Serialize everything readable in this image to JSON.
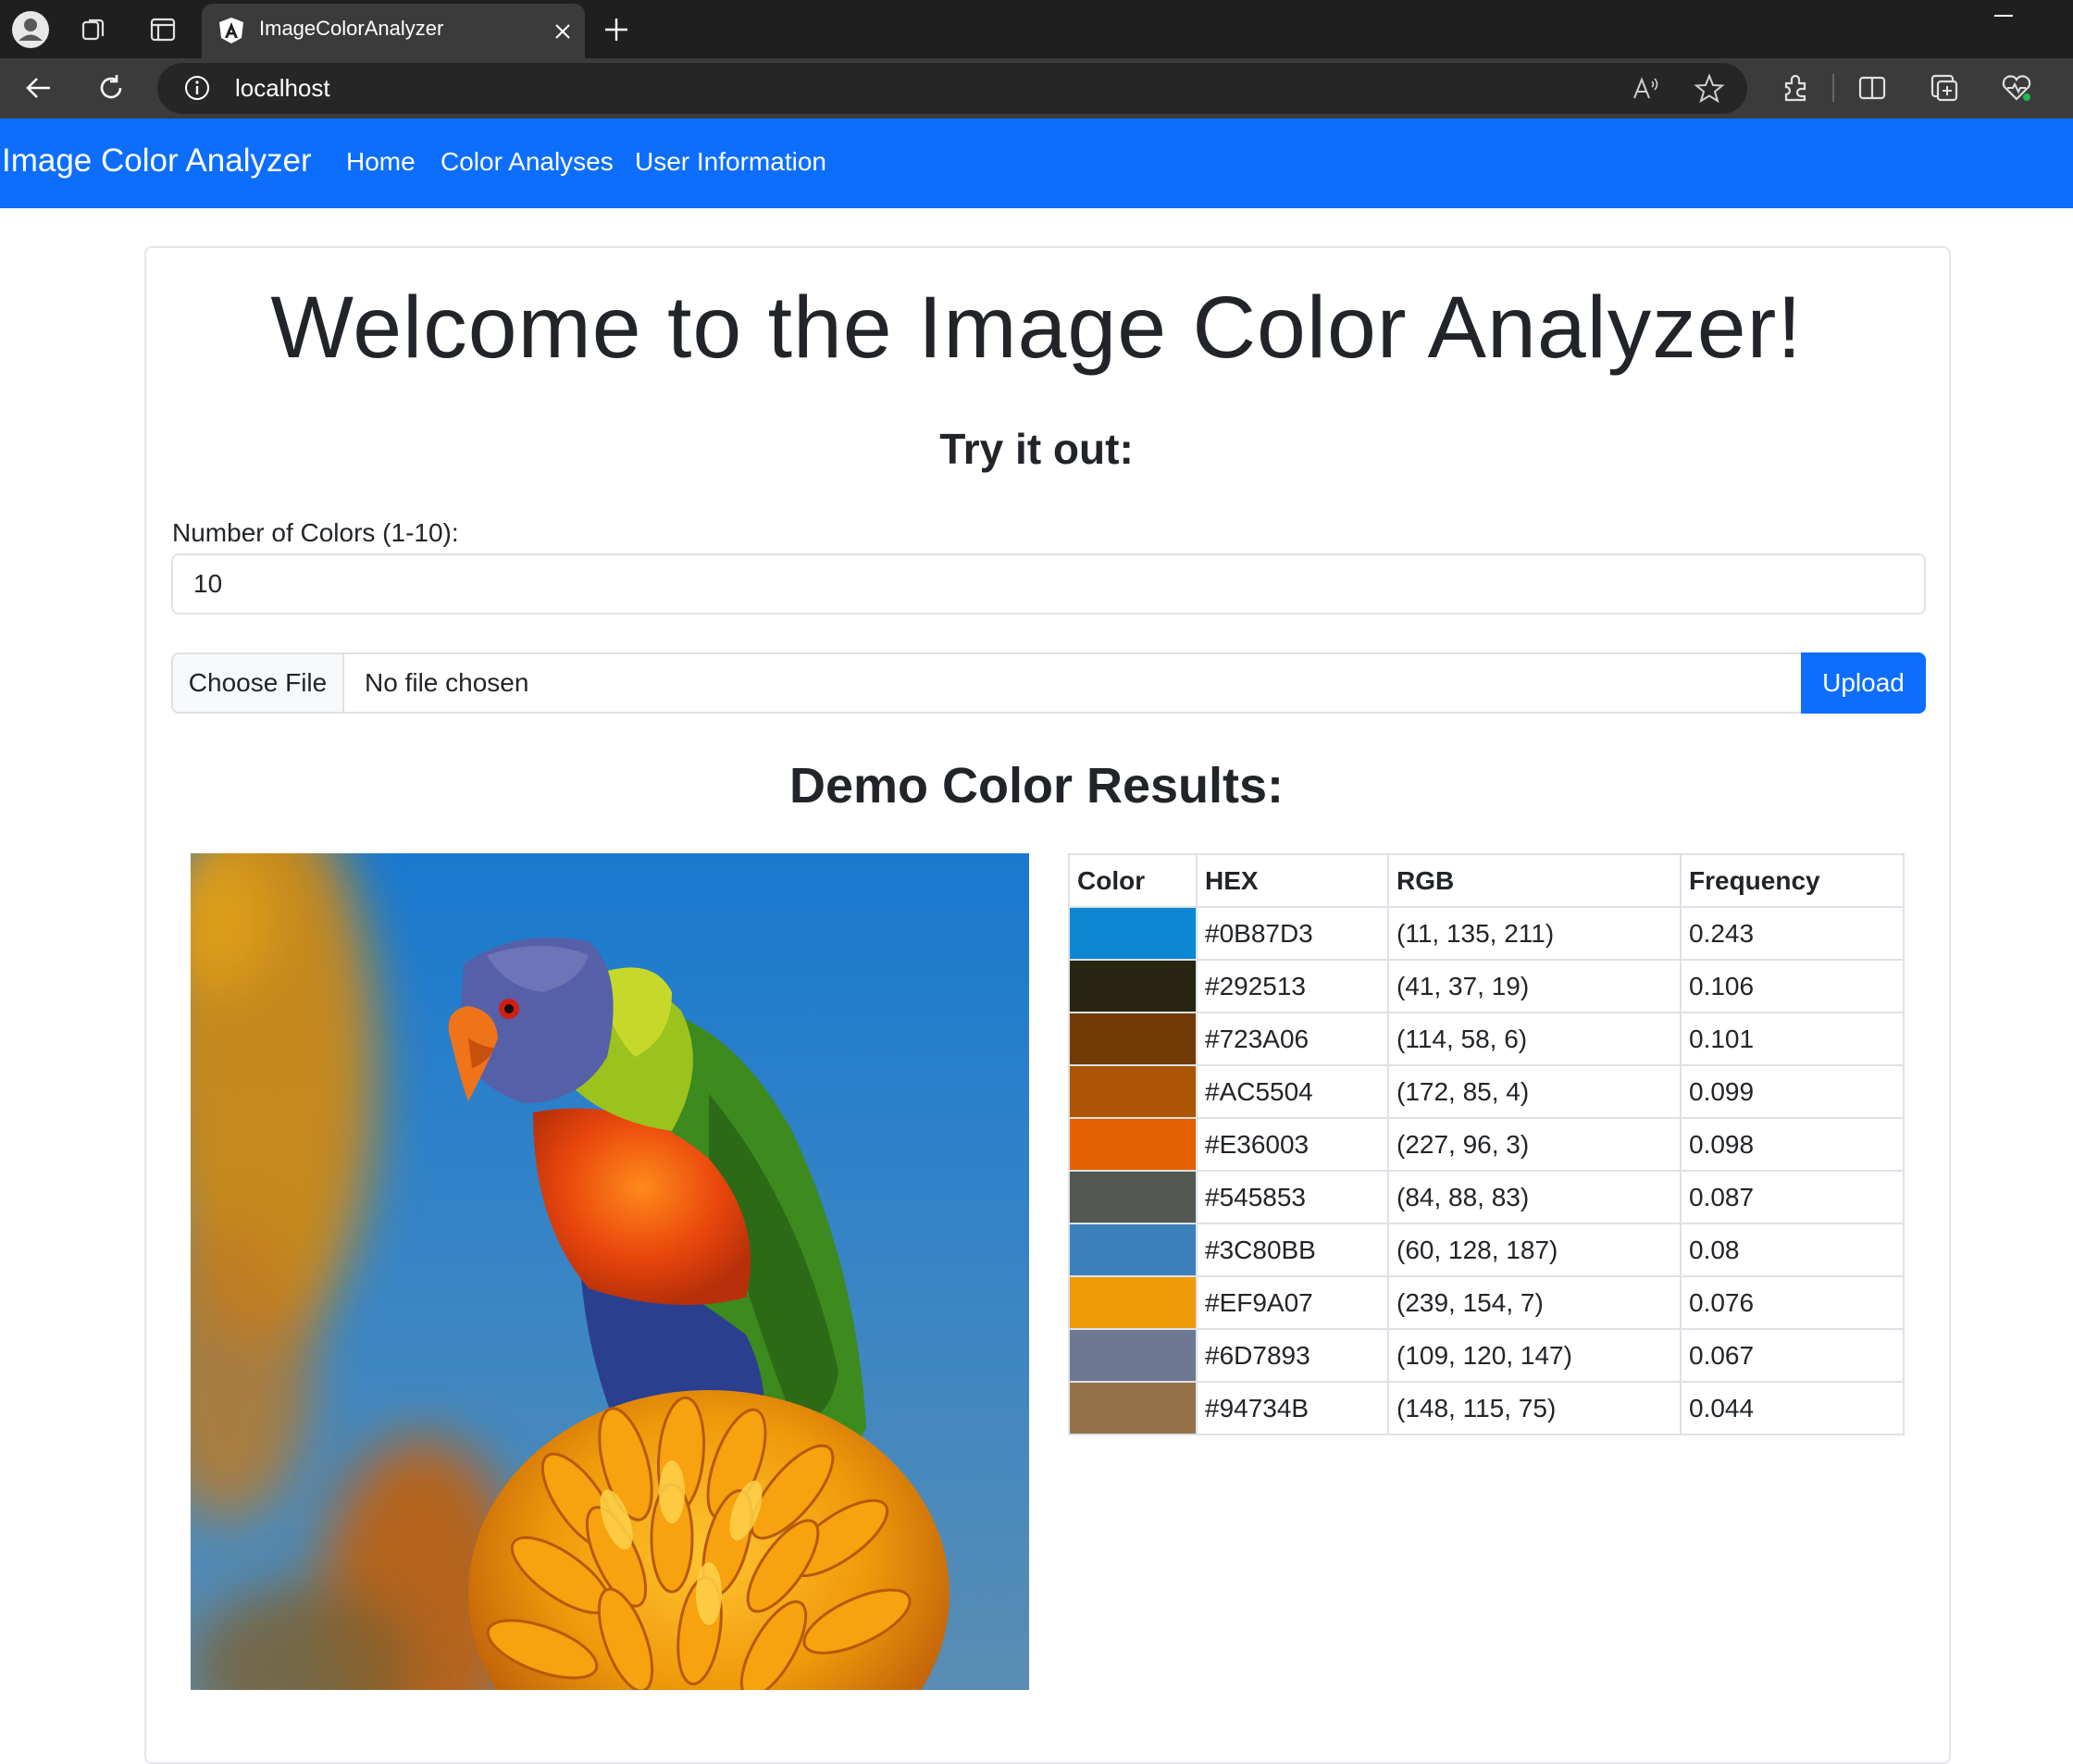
{
  "browser": {
    "tab_title": "ImageColorAnalyzer",
    "address": "localhost"
  },
  "navbar": {
    "brand": "Image Color Analyzer",
    "links": [
      "Home",
      "Color Analyses",
      "User Information"
    ]
  },
  "main": {
    "title": "Welcome to the Image Color Analyzer!",
    "subtitle": "Try it out:",
    "num_colors_label": "Number of Colors (1-10):",
    "num_colors_value": "10",
    "choose_file_label": "Choose File",
    "no_file_text": "No file chosen",
    "upload_label": "Upload",
    "results_heading": "Demo Color Results:"
  },
  "table": {
    "headers": [
      "Color",
      "HEX",
      "RGB",
      "Frequency"
    ],
    "rows": [
      {
        "hex": "#0B87D3",
        "rgb": "(11, 135, 211)",
        "freq": "0.243"
      },
      {
        "hex": "#292513",
        "rgb": "(41, 37, 19)",
        "freq": "0.106"
      },
      {
        "hex": "#723A06",
        "rgb": "(114, 58, 6)",
        "freq": "0.101"
      },
      {
        "hex": "#AC5504",
        "rgb": "(172, 85, 4)",
        "freq": "0.099"
      },
      {
        "hex": "#E36003",
        "rgb": "(227, 96, 3)",
        "freq": "0.098"
      },
      {
        "hex": "#545853",
        "rgb": "(84, 88, 83)",
        "freq": "0.087"
      },
      {
        "hex": "#3C80BB",
        "rgb": "(60, 128, 187)",
        "freq": "0.08"
      },
      {
        "hex": "#EF9A07",
        "rgb": "(239, 154, 7)",
        "freq": "0.076"
      },
      {
        "hex": "#6D7893",
        "rgb": "(109, 120, 147)",
        "freq": "0.067"
      },
      {
        "hex": "#94734B",
        "rgb": "(148, 115, 75)",
        "freq": "0.044"
      }
    ]
  },
  "colors": {
    "navbar": "#0d6efd",
    "upload_button": "#0d6efd",
    "chrome_dark": "#1f1f1f",
    "chrome_toolbar": "#3b3b3b"
  },
  "icons": [
    "profile-icon",
    "workspaces-icon",
    "tab-actions-icon",
    "angular-icon",
    "close-icon",
    "plus-icon",
    "back-arrow-icon",
    "refresh-icon",
    "info-icon",
    "read-aloud-icon",
    "favorite-star-icon",
    "extensions-icon",
    "split-screen-icon",
    "collections-icon",
    "browser-health-icon",
    "minimize-icon"
  ]
}
